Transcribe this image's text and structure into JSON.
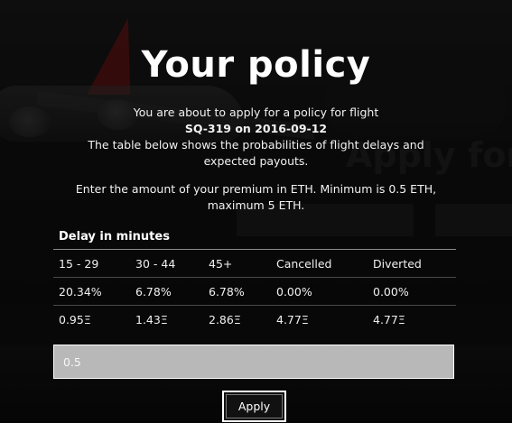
{
  "modal": {
    "title": "Your policy",
    "intro_line": "You are about to apply for a policy for flight",
    "flight_line": "SQ-319 on 2016-09-12",
    "table_description": "The table below shows the probabilities of flight delays and expected payouts.",
    "premium_instructions": "Enter the amount of your premium in ETH. Minimum is 0.5 ETH, maximum 5 ETH."
  },
  "delay_table": {
    "caption": "Delay in minutes",
    "headers": [
      "15 - 29",
      "30 - 44",
      "45+",
      "Cancelled",
      "Diverted"
    ],
    "probabilities": [
      "20.34%",
      "6.78%",
      "6.78%",
      "0.00%",
      "0.00%"
    ],
    "payouts": [
      "0.95Ξ",
      "1.43Ξ",
      "2.86Ξ",
      "4.77Ξ",
      "4.77Ξ"
    ]
  },
  "premium_input": {
    "value": "0.5"
  },
  "apply_button": {
    "label": "Apply"
  },
  "background": {
    "page_heading": "Apply for"
  }
}
